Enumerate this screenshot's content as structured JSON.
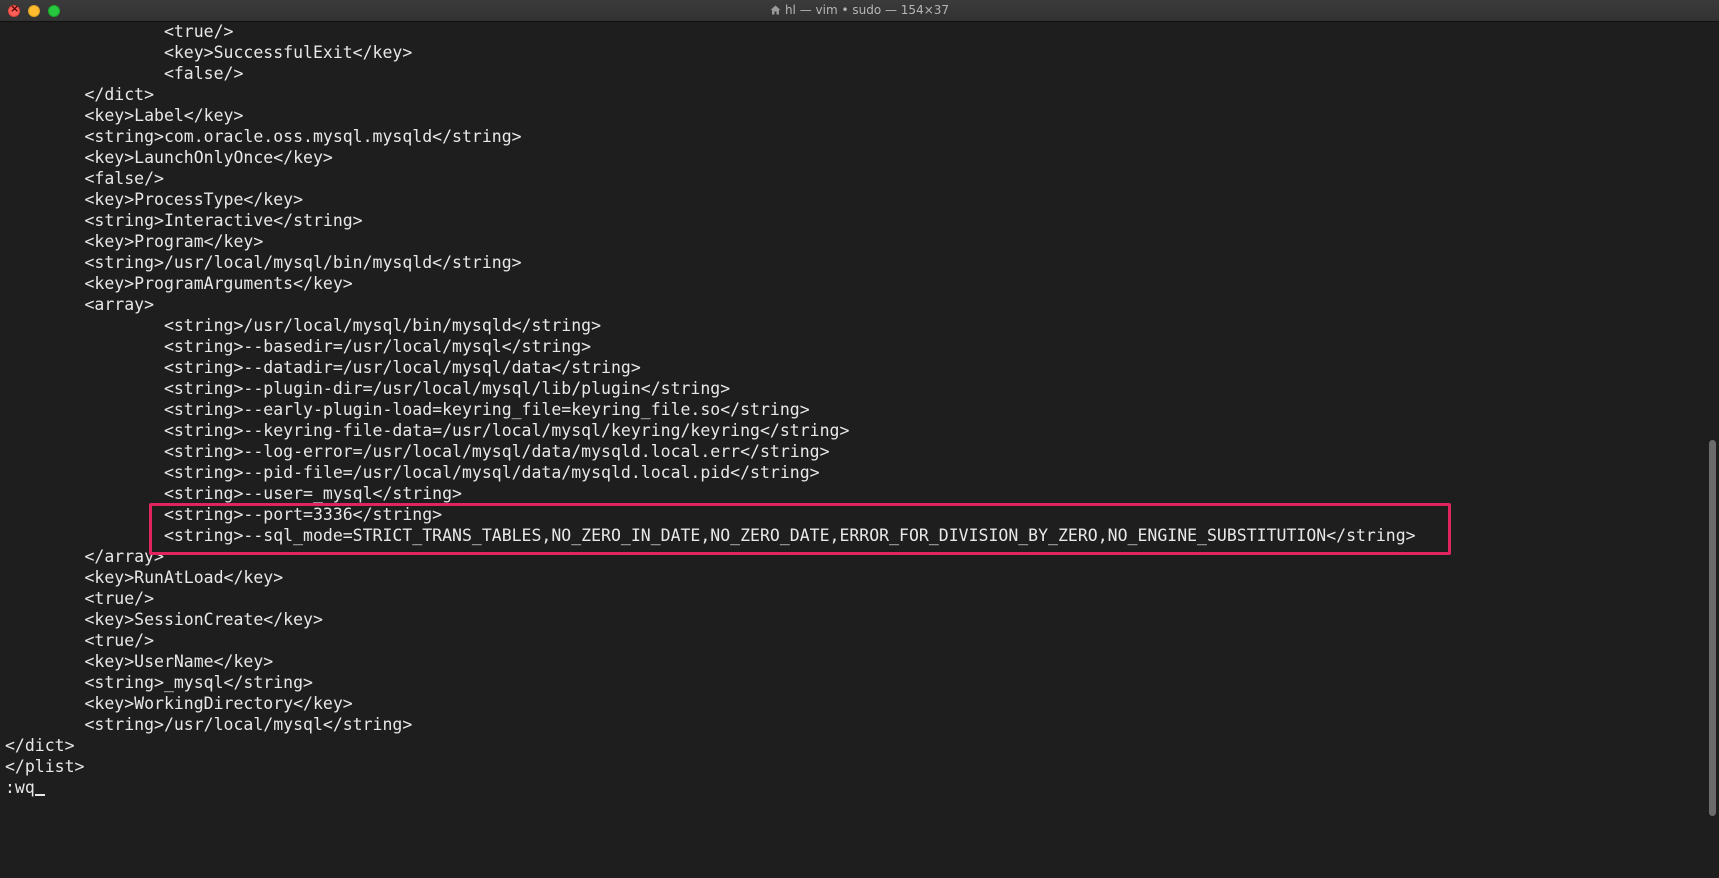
{
  "window": {
    "title": "hl — vim • sudo — 154×37",
    "buttons": {
      "close": "close",
      "minimize": "minimize",
      "zoom": "zoom"
    },
    "icon": "home-icon"
  },
  "editor": {
    "lines": [
      "                <true/>",
      "                <key>SuccessfulExit</key>",
      "                <false/>",
      "        </dict>",
      "        <key>Label</key>",
      "        <string>com.oracle.oss.mysql.mysqld</string>",
      "        <key>LaunchOnlyOnce</key>",
      "        <false/>",
      "        <key>ProcessType</key>",
      "        <string>Interactive</string>",
      "        <key>Program</key>",
      "        <string>/usr/local/mysql/bin/mysqld</string>",
      "        <key>ProgramArguments</key>",
      "        <array>",
      "                <string>/usr/local/mysql/bin/mysqld</string>",
      "                <string>--basedir=/usr/local/mysql</string>",
      "                <string>--datadir=/usr/local/mysql/data</string>",
      "                <string>--plugin-dir=/usr/local/mysql/lib/plugin</string>",
      "                <string>--early-plugin-load=keyring_file=keyring_file.so</string>",
      "                <string>--keyring-file-data=/usr/local/mysql/keyring/keyring</string>",
      "                <string>--log-error=/usr/local/mysql/data/mysqld.local.err</string>",
      "                <string>--pid-file=/usr/local/mysql/data/mysqld.local.pid</string>",
      "                <string>--user=_mysql</string>",
      "                <string>--port=3336</string>",
      "                <string>--sql_mode=STRICT_TRANS_TABLES,NO_ZERO_IN_DATE,NO_ZERO_DATE,ERROR_FOR_DIVISION_BY_ZERO,NO_ENGINE_SUBSTITUTION</string>",
      "        </array>",
      "        <key>RunAtLoad</key>",
      "        <true/>",
      "        <key>SessionCreate</key>",
      "        <true/>",
      "        <key>UserName</key>",
      "        <string>_mysql</string>",
      "        <key>WorkingDirectory</key>",
      "        <string>/usr/local/mysql</string>",
      "</dict>",
      "</plist>"
    ],
    "command": ":wq",
    "highlight_color": "#e0245e"
  }
}
